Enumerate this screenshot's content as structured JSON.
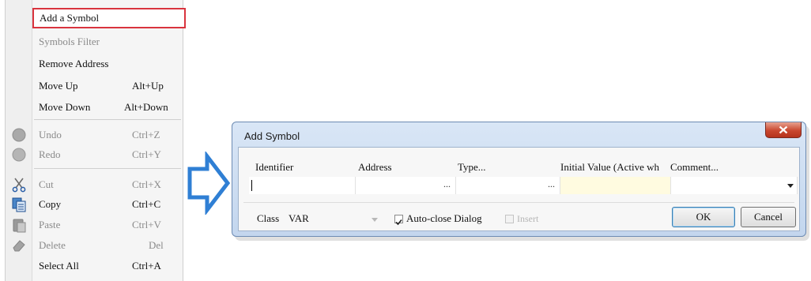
{
  "context_menu": {
    "items": [
      {
        "label": "Add a Symbol",
        "shortcut": "",
        "state": "highlighted"
      },
      {
        "label": "Symbols Filter",
        "shortcut": "",
        "state": "disabled"
      },
      {
        "label": "Remove Address",
        "shortcut": "",
        "state": "enabled"
      },
      {
        "label": "Move Up",
        "shortcut": "Alt+Up",
        "state": "enabled"
      },
      {
        "label": "Move Down",
        "shortcut": "Alt+Down",
        "state": "enabled"
      },
      {
        "label": "Undo",
        "shortcut": "Ctrl+Z",
        "state": "disabled",
        "icon": "undo-icon"
      },
      {
        "label": "Redo",
        "shortcut": "Ctrl+Y",
        "state": "disabled",
        "icon": "redo-icon"
      },
      {
        "label": "Cut",
        "shortcut": "Ctrl+X",
        "state": "disabled",
        "icon": "scissors-icon"
      },
      {
        "label": "Copy",
        "shortcut": "Ctrl+C",
        "state": "enabled",
        "icon": "copy-icon"
      },
      {
        "label": "Paste",
        "shortcut": "Ctrl+V",
        "state": "disabled",
        "icon": "paste-icon"
      },
      {
        "label": "Delete",
        "shortcut": "Del",
        "state": "disabled",
        "icon": "eraser-icon"
      },
      {
        "label": "Select All",
        "shortcut": "Ctrl+A",
        "state": "enabled"
      }
    ]
  },
  "arrow": {
    "icon": "right-arrow-icon",
    "color": "#2f7fd4"
  },
  "dialog": {
    "title": "Add Symbol",
    "close_icon": "close-icon",
    "columns": {
      "identifier": "Identifier",
      "address": "Address",
      "type": "Type...",
      "initial_value": "Initial Value (Active wh",
      "comment": "Comment..."
    },
    "ellipsis": "...",
    "identifier_value": "",
    "class_label": "Class",
    "class_value": "VAR",
    "auto_close_label": "Auto-close Dialog",
    "auto_close_checked": true,
    "insert_label": "Insert",
    "insert_checked": false,
    "ok_label": "OK",
    "cancel_label": "Cancel"
  },
  "colors": {
    "highlight_border": "#d9343e",
    "dialog_frame": "#c8daf0",
    "initial_value_cell": "#fffbe0"
  }
}
